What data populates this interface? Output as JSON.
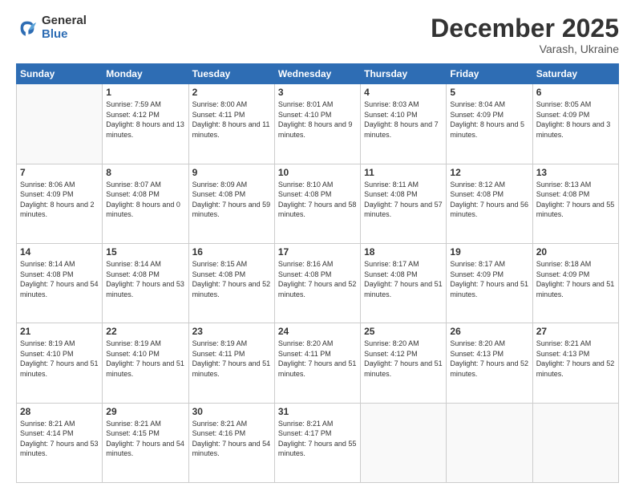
{
  "logo": {
    "general": "General",
    "blue": "Blue"
  },
  "title": "December 2025",
  "location": "Varash, Ukraine",
  "weekdays": [
    "Sunday",
    "Monday",
    "Tuesday",
    "Wednesday",
    "Thursday",
    "Friday",
    "Saturday"
  ],
  "weeks": [
    [
      null,
      {
        "day": "1",
        "sunrise": "7:59 AM",
        "sunset": "4:12 PM",
        "daylight": "8 hours and 13 minutes."
      },
      {
        "day": "2",
        "sunrise": "8:00 AM",
        "sunset": "4:11 PM",
        "daylight": "8 hours and 11 minutes."
      },
      {
        "day": "3",
        "sunrise": "8:01 AM",
        "sunset": "4:10 PM",
        "daylight": "8 hours and 9 minutes."
      },
      {
        "day": "4",
        "sunrise": "8:03 AM",
        "sunset": "4:10 PM",
        "daylight": "8 hours and 7 minutes."
      },
      {
        "day": "5",
        "sunrise": "8:04 AM",
        "sunset": "4:09 PM",
        "daylight": "8 hours and 5 minutes."
      },
      {
        "day": "6",
        "sunrise": "8:05 AM",
        "sunset": "4:09 PM",
        "daylight": "8 hours and 3 minutes."
      }
    ],
    [
      {
        "day": "7",
        "sunrise": "8:06 AM",
        "sunset": "4:09 PM",
        "daylight": "8 hours and 2 minutes."
      },
      {
        "day": "8",
        "sunrise": "8:07 AM",
        "sunset": "4:08 PM",
        "daylight": "8 hours and 0 minutes."
      },
      {
        "day": "9",
        "sunrise": "8:09 AM",
        "sunset": "4:08 PM",
        "daylight": "7 hours and 59 minutes."
      },
      {
        "day": "10",
        "sunrise": "8:10 AM",
        "sunset": "4:08 PM",
        "daylight": "7 hours and 58 minutes."
      },
      {
        "day": "11",
        "sunrise": "8:11 AM",
        "sunset": "4:08 PM",
        "daylight": "7 hours and 57 minutes."
      },
      {
        "day": "12",
        "sunrise": "8:12 AM",
        "sunset": "4:08 PM",
        "daylight": "7 hours and 56 minutes."
      },
      {
        "day": "13",
        "sunrise": "8:13 AM",
        "sunset": "4:08 PM",
        "daylight": "7 hours and 55 minutes."
      }
    ],
    [
      {
        "day": "14",
        "sunrise": "8:14 AM",
        "sunset": "4:08 PM",
        "daylight": "7 hours and 54 minutes."
      },
      {
        "day": "15",
        "sunrise": "8:14 AM",
        "sunset": "4:08 PM",
        "daylight": "7 hours and 53 minutes."
      },
      {
        "day": "16",
        "sunrise": "8:15 AM",
        "sunset": "4:08 PM",
        "daylight": "7 hours and 52 minutes."
      },
      {
        "day": "17",
        "sunrise": "8:16 AM",
        "sunset": "4:08 PM",
        "daylight": "7 hours and 52 minutes."
      },
      {
        "day": "18",
        "sunrise": "8:17 AM",
        "sunset": "4:08 PM",
        "daylight": "7 hours and 51 minutes."
      },
      {
        "day": "19",
        "sunrise": "8:17 AM",
        "sunset": "4:09 PM",
        "daylight": "7 hours and 51 minutes."
      },
      {
        "day": "20",
        "sunrise": "8:18 AM",
        "sunset": "4:09 PM",
        "daylight": "7 hours and 51 minutes."
      }
    ],
    [
      {
        "day": "21",
        "sunrise": "8:19 AM",
        "sunset": "4:10 PM",
        "daylight": "7 hours and 51 minutes."
      },
      {
        "day": "22",
        "sunrise": "8:19 AM",
        "sunset": "4:10 PM",
        "daylight": "7 hours and 51 minutes."
      },
      {
        "day": "23",
        "sunrise": "8:19 AM",
        "sunset": "4:11 PM",
        "daylight": "7 hours and 51 minutes."
      },
      {
        "day": "24",
        "sunrise": "8:20 AM",
        "sunset": "4:11 PM",
        "daylight": "7 hours and 51 minutes."
      },
      {
        "day": "25",
        "sunrise": "8:20 AM",
        "sunset": "4:12 PM",
        "daylight": "7 hours and 51 minutes."
      },
      {
        "day": "26",
        "sunrise": "8:20 AM",
        "sunset": "4:13 PM",
        "daylight": "7 hours and 52 minutes."
      },
      {
        "day": "27",
        "sunrise": "8:21 AM",
        "sunset": "4:13 PM",
        "daylight": "7 hours and 52 minutes."
      }
    ],
    [
      {
        "day": "28",
        "sunrise": "8:21 AM",
        "sunset": "4:14 PM",
        "daylight": "7 hours and 53 minutes."
      },
      {
        "day": "29",
        "sunrise": "8:21 AM",
        "sunset": "4:15 PM",
        "daylight": "7 hours and 54 minutes."
      },
      {
        "day": "30",
        "sunrise": "8:21 AM",
        "sunset": "4:16 PM",
        "daylight": "7 hours and 54 minutes."
      },
      {
        "day": "31",
        "sunrise": "8:21 AM",
        "sunset": "4:17 PM",
        "daylight": "7 hours and 55 minutes."
      },
      null,
      null,
      null
    ]
  ]
}
